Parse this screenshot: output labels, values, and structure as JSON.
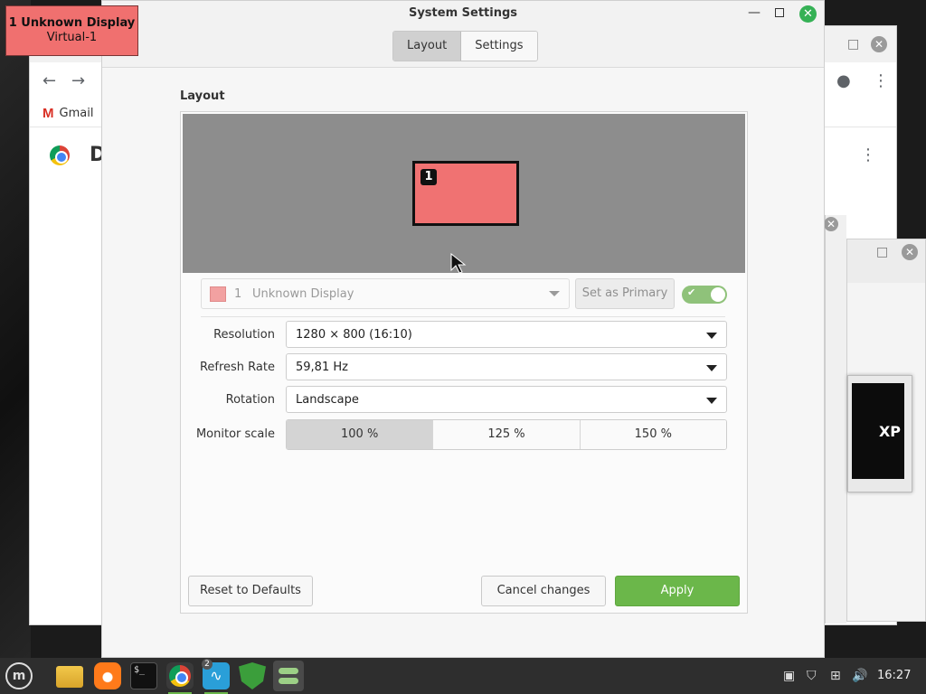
{
  "osd": {
    "line1": "1  Unknown Display",
    "line2": "Virtual-1"
  },
  "background": {
    "gmail_label": "Gmail",
    "chrome_heading_initial": "D",
    "right_window_text": "XP"
  },
  "window": {
    "title": "System Settings",
    "tabs": [
      {
        "label": "Layout",
        "active": true
      },
      {
        "label": "Settings",
        "active": false
      }
    ]
  },
  "layout": {
    "heading": "Layout",
    "monitor_badge": "1",
    "display_select": {
      "number": "1",
      "name": "Unknown Display"
    },
    "set_primary_label": "Set as Primary",
    "enabled_toggle": true,
    "fields": {
      "resolution": {
        "label": "Resolution",
        "value": "1280 × 800 (16:10)"
      },
      "refresh_rate": {
        "label": "Refresh Rate",
        "value": "59,81 Hz"
      },
      "rotation": {
        "label": "Rotation",
        "value": "Landscape"
      },
      "monitor_scale": {
        "label": "Monitor scale",
        "options": [
          "100 %",
          "125 %",
          "150 %"
        ],
        "selected": "100 %"
      }
    },
    "buttons": {
      "reset": "Reset to Defaults",
      "cancel": "Cancel changes",
      "apply": "Apply"
    }
  },
  "colors": {
    "accent": "#6bb74a",
    "monitor": "#f07272",
    "preview_bg": "#8d8d8d"
  },
  "taskbar": {
    "apps": [
      "mint-menu",
      "files",
      "firefox",
      "terminal",
      "chrome",
      "system-monitor",
      "update-manager",
      "system-settings"
    ],
    "monitor_app_badge": "2",
    "terminal_glyph": "$_",
    "clock": "16:27"
  }
}
